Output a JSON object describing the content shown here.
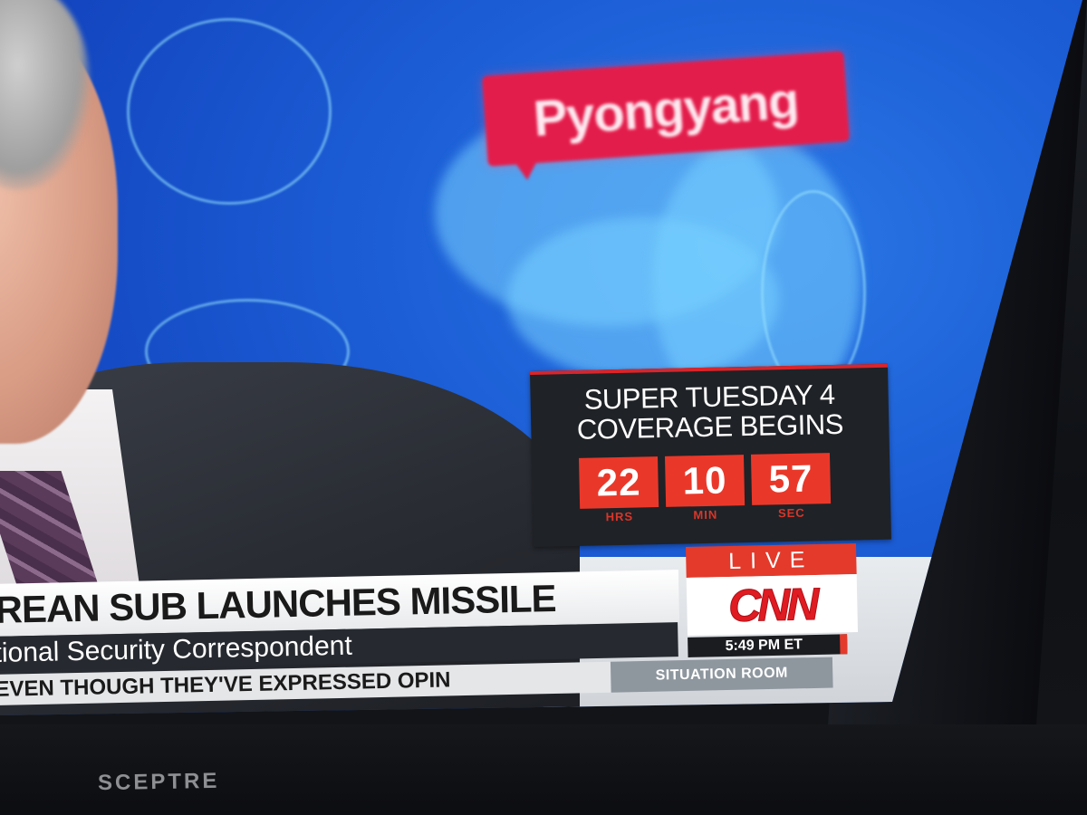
{
  "map": {
    "city_label": "Pyongyang"
  },
  "countdown": {
    "title_line1": "SUPER TUESDAY 4",
    "title_line2": "COVERAGE BEGINS",
    "hours": "22",
    "minutes": "10",
    "seconds": "57",
    "hours_unit": "HRS",
    "minutes_unit": "MIN",
    "seconds_unit": "SEC"
  },
  "network": {
    "live_label": "LIVE",
    "logo_text": "CNN",
    "time": "5:49 PM ET"
  },
  "lower_third": {
    "headline": "REAN SUB LAUNCHES MISSILE",
    "subtitle": "tional Security Correspondent",
    "ticker": "EVEN THOUGH THEY'VE EXPRESSED OPIN",
    "show_name": "SITUATION ROOM"
  },
  "tv": {
    "brand": "SCEPTRE"
  },
  "colors": {
    "cnn_red": "#e01b22",
    "live_red": "#e33a2b",
    "map_blue": "#1c5ed6"
  }
}
